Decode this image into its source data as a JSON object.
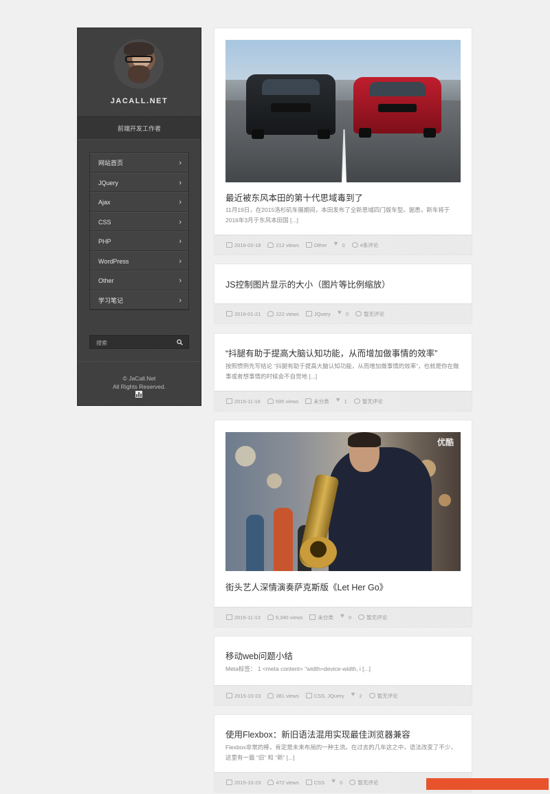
{
  "sidebar": {
    "site_name": "JACALL.NET",
    "tagline": "前端开发工作者",
    "nav": [
      {
        "label": "网站首页"
      },
      {
        "label": "JQuery"
      },
      {
        "label": "Ajax"
      },
      {
        "label": "CSS"
      },
      {
        "label": "PHP"
      },
      {
        "label": "WordPress"
      },
      {
        "label": "Other"
      },
      {
        "label": "学习笔记"
      }
    ],
    "search_placeholder": "搜索",
    "copyright_line1": "© JaCall.Net",
    "copyright_line2": "All Rights Reserved."
  },
  "posts": [
    {
      "title": "最近被东风本田的第十代思域毒到了",
      "excerpt": "11月19日，在2015洛杉矶车展期间，本田发布了全新思域四门版车型。据悉，新车将于2016年3月于东风本田国 [...]",
      "date": "2016-02-18",
      "views": "212 views",
      "category": "Other",
      "likes": "0",
      "comments": "4条评论"
    },
    {
      "title": "JS控制图片显示的大小（图片等比例缩放）",
      "excerpt": "",
      "date": "2016-01-21",
      "views": "222 views",
      "category": "JQuery",
      "likes": "0",
      "comments": "暂无评论"
    },
    {
      "title": "“抖腿有助于提高大脑认知功能，从而增加做事情的效率”",
      "excerpt": "按照惯例先写结论 “抖腿有助于提高大脑认知功能，从而增加做事情的效率”，也就是你在做事或者想事情的时候会不自觉地 [...]",
      "date": "2015-11-16",
      "views": "595 views",
      "category": "未分类",
      "likes": "1",
      "comments": "暂无评论"
    },
    {
      "title": "街头艺人深情演奏萨克斯版《Let Her Go》",
      "excerpt": "",
      "watermark": "优酷",
      "date": "2015-11-13",
      "views": "9,340 views",
      "category": "未分类",
      "likes": "0",
      "comments": "暂无评论"
    },
    {
      "title": "移动web问题小结",
      "excerpt": "Meta标签： 1 <meta content= “width=device-width, i [...]",
      "date": "2015-10-23",
      "views": "381 views",
      "category": "CSS, JQuery",
      "likes": "2",
      "comments": "暂无评论"
    },
    {
      "title": "使用Flexbox：新旧语法混用实现最佳浏览器兼容",
      "excerpt": "Flexbox非常的棒，肯定是未来布局的一种主流。在过去的几年这之中，语法改变了不少，这里有一篇 “旧” 和 “新” [...]",
      "date": "2015-10-23",
      "views": "472 views",
      "category": "CSS",
      "likes": "0",
      "comments": "暂无评论"
    }
  ],
  "colors": {
    "accent_bar": "#e8532c",
    "sidebar_bg": "#3e3e3e"
  }
}
